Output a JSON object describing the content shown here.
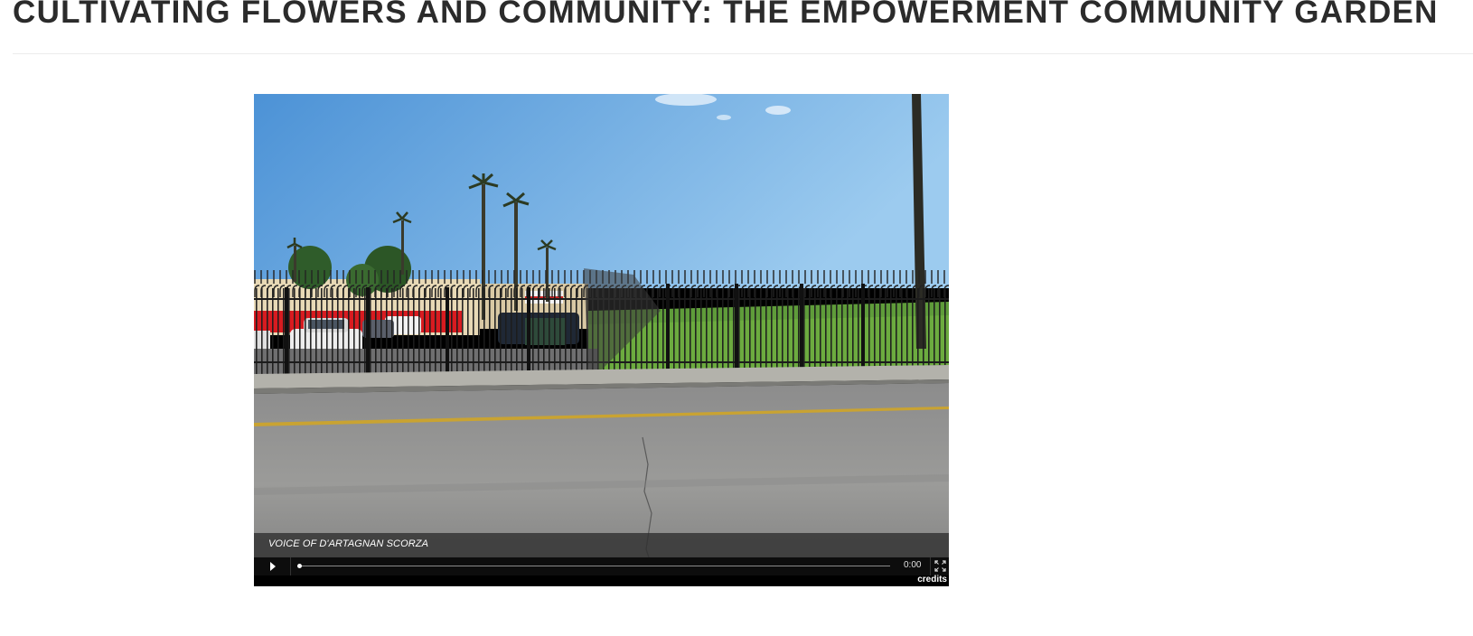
{
  "page": {
    "title": "CULTIVATING FLOWERS AND COMMUNITY: THE EMPOWERMENT COMMUNITY GARDEN"
  },
  "player": {
    "caption": "VOICE OF D'ARTAGNAN SCORZA",
    "time": "0:00",
    "progress": 0,
    "credits_label": "credits",
    "play_icon": "play-icon",
    "fullscreen_icon": "fullscreen-icon"
  }
}
